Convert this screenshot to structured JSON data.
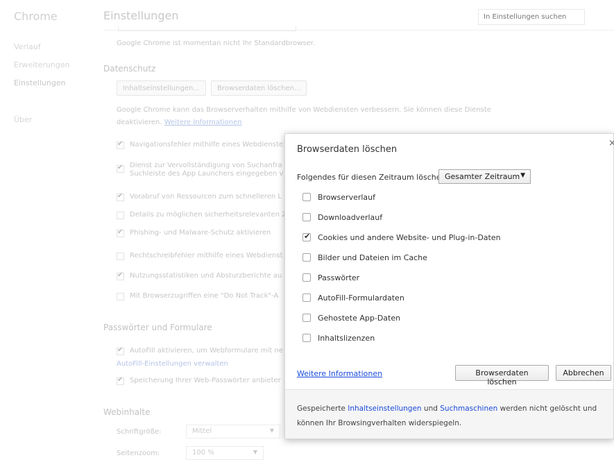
{
  "sidebar": {
    "brand": "Chrome",
    "items": [
      {
        "label": "Verlauf"
      },
      {
        "label": "Erweiterungen"
      },
      {
        "label": "Einstellungen"
      },
      {
        "label": "Über"
      }
    ]
  },
  "header": {
    "title": "Einstellungen",
    "search_placeholder": "In Einstellungen suchen"
  },
  "default_browser_text": "Google Chrome ist momentan nicht Ihr Standardbrowser.",
  "privacy": {
    "title": "Datenschutz",
    "content_settings_button": "Inhaltseinstellungen...",
    "clear_data_button": "Browserdaten löschen...",
    "description_line1": "Google Chrome kann das Browserverhalten mithilfe von Webdiensten verbessern. Sie können diese Dienste",
    "description_line2": "deaktivieren.",
    "learn_more": "Weitere Informationen",
    "checkboxes": [
      {
        "label": "Navigationsfehler mithilfe eines Webdienste",
        "checked": true
      },
      {
        "label": "Dienst zur Vervollständigung von Suchanfra",
        "label2": "Suchleiste des App Launchers eingegeben v",
        "checked": true
      },
      {
        "label": "Vorabruf von Ressourcen zum schnelleren L",
        "checked": true
      },
      {
        "label": "Details zu möglichen sicherheitsrelevanten Z",
        "checked": false
      },
      {
        "label": "Phishing- und Malware-Schutz aktivieren",
        "checked": true
      },
      {
        "label": "Rechtschreibfehler mithilfe eines Webdienst",
        "checked": false
      },
      {
        "label": "Nutzungsstatistiken und Absturzberichte au",
        "checked": true
      },
      {
        "label": "Mit Browserzugriffen eine \"Do Not Track\"-A",
        "checked": false
      }
    ]
  },
  "passwords": {
    "title": "Passwörter und Formulare",
    "autofill_label": "AutoFill aktivieren, um Webformulare mit ne",
    "autofill_settings_link": "AutoFill-Einstellungen verwalten",
    "save_passwords_label": "Speicherung Ihrer Web-Passwörter anbieter"
  },
  "web_content": {
    "title": "Webinhalte",
    "font_size_label": "Schriftgröße:",
    "font_size_value": "Mittel",
    "zoom_label": "Seitenzoom:",
    "zoom_value": "100 %"
  },
  "dialog": {
    "title": "Browserdaten löschen",
    "close": "×",
    "range_label": "Folgendes für diesen Zeitraum löschen:",
    "range_value": "Gesamter Zeitraum",
    "options": [
      {
        "label": "Browserverlauf",
        "checked": false
      },
      {
        "label": "Downloadverlauf",
        "checked": false
      },
      {
        "label": "Cookies und andere Website- und Plug-in-Daten",
        "checked": true
      },
      {
        "label": "Bilder und Dateien im Cache",
        "checked": false
      },
      {
        "label": "Passwörter",
        "checked": false
      },
      {
        "label": "AutoFill-Formulardaten",
        "checked": false
      },
      {
        "label": "Gehostete App-Daten",
        "checked": false
      },
      {
        "label": "Inhaltslizenzen",
        "checked": false
      }
    ],
    "learn_more": "Weitere Informationen",
    "confirm_button": "Browserdaten löschen",
    "cancel_button": "Abbrechen",
    "footer": {
      "t1": "Gespeicherte ",
      "link1": "Inhaltseinstellungen",
      "t2": " und ",
      "link2": "Suchmaschinen",
      "t3": " werden nicht gelöscht und",
      "t4": "können Ihr Browsingverhalten widerspiegeln."
    }
  }
}
